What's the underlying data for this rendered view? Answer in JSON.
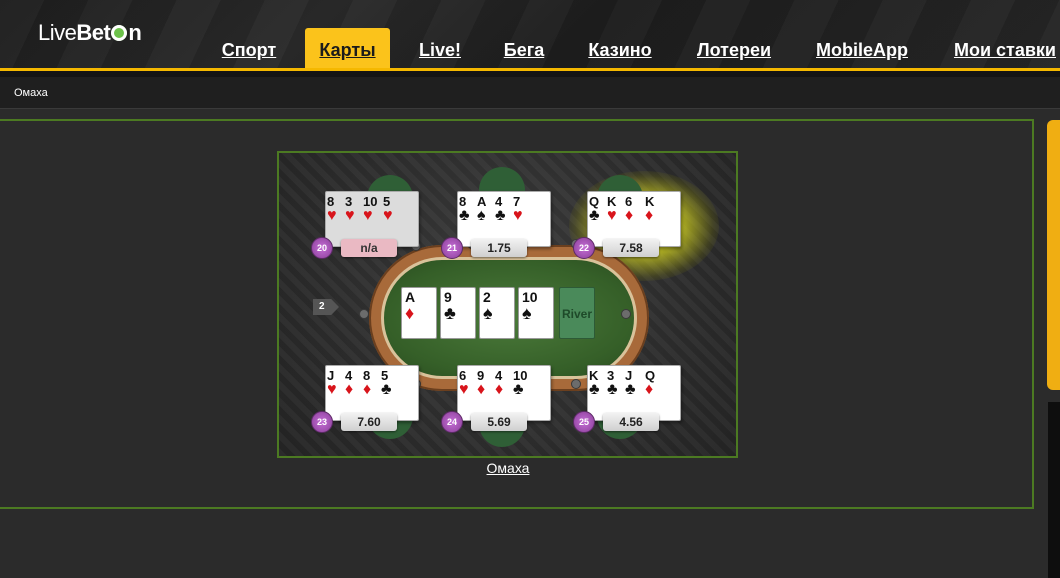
{
  "logo": {
    "text_live": "Live",
    "text_bet": "Bet",
    "text_on": "n"
  },
  "nav": [
    {
      "label": "Спорт",
      "active": false
    },
    {
      "label": "Карты",
      "active": true
    },
    {
      "label": "Live!",
      "active": false
    },
    {
      "label": "Бега",
      "active": false
    },
    {
      "label": "Казино",
      "active": false
    },
    {
      "label": "Лотереи",
      "active": false
    },
    {
      "label": "MobileApp",
      "active": false
    },
    {
      "label": "Мои ставки",
      "active": false
    }
  ],
  "breadcrumb": "Омаха",
  "game": {
    "caption": "Омаха",
    "arrow_label": "2",
    "river_label": "River",
    "board": [
      {
        "rank": "A",
        "suit": "♦",
        "color": "red"
      },
      {
        "rank": "9",
        "suit": "♣",
        "color": "black"
      },
      {
        "rank": "2",
        "suit": "♠",
        "color": "black"
      },
      {
        "rank": "10",
        "suit": "♠",
        "color": "black"
      }
    ],
    "hands": [
      {
        "seat": "20",
        "odds": "n/a",
        "cards": [
          {
            "rank": "8",
            "suit": "♥",
            "color": "red"
          },
          {
            "rank": "3",
            "suit": "♥",
            "color": "red"
          },
          {
            "rank": "10",
            "suit": "♥",
            "color": "red"
          },
          {
            "rank": "5",
            "suit": "♥",
            "color": "red"
          }
        ]
      },
      {
        "seat": "21",
        "odds": "1.75",
        "cards": [
          {
            "rank": "8",
            "suit": "♣",
            "color": "black"
          },
          {
            "rank": "A",
            "suit": "♠",
            "color": "black"
          },
          {
            "rank": "4",
            "suit": "♣",
            "color": "black"
          },
          {
            "rank": "7",
            "suit": "♥",
            "color": "red"
          }
        ]
      },
      {
        "seat": "22",
        "odds": "7.58",
        "cards": [
          {
            "rank": "Q",
            "suit": "♣",
            "color": "black"
          },
          {
            "rank": "K",
            "suit": "♥",
            "color": "red"
          },
          {
            "rank": "6",
            "suit": "♦",
            "color": "red"
          },
          {
            "rank": "K",
            "suit": "♦",
            "color": "red"
          }
        ]
      },
      {
        "seat": "23",
        "odds": "7.60",
        "cards": [
          {
            "rank": "J",
            "suit": "♥",
            "color": "red"
          },
          {
            "rank": "4",
            "suit": "♦",
            "color": "red"
          },
          {
            "rank": "8",
            "suit": "♦",
            "color": "red"
          },
          {
            "rank": "5",
            "suit": "♣",
            "color": "black"
          }
        ]
      },
      {
        "seat": "24",
        "odds": "5.69",
        "cards": [
          {
            "rank": "6",
            "suit": "♥",
            "color": "red"
          },
          {
            "rank": "9",
            "suit": "♦",
            "color": "red"
          },
          {
            "rank": "4",
            "suit": "♦",
            "color": "red"
          },
          {
            "rank": "10",
            "suit": "♣",
            "color": "black"
          }
        ]
      },
      {
        "seat": "25",
        "odds": "4.56",
        "cards": [
          {
            "rank": "K",
            "suit": "♣",
            "color": "black"
          },
          {
            "rank": "3",
            "suit": "♣",
            "color": "black"
          },
          {
            "rank": "J",
            "suit": "♣",
            "color": "black"
          },
          {
            "rank": "Q",
            "suit": "♦",
            "color": "red"
          }
        ]
      }
    ]
  },
  "colors": {
    "accent": "#fbc31b",
    "panel_border": "#4c7a22",
    "background": "#2b2b2b"
  }
}
